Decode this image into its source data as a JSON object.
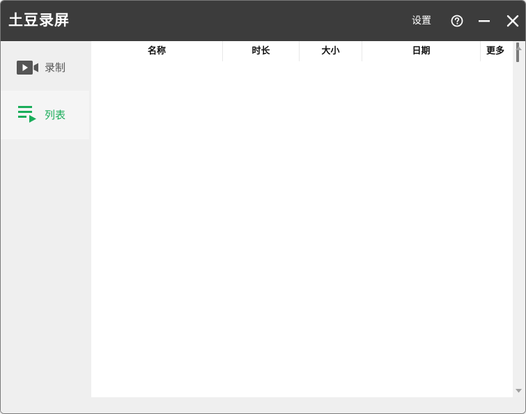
{
  "titlebar": {
    "title": "土豆录屏",
    "settings_label": "设置",
    "help_icon": "help-circle-icon",
    "minimize_icon": "minimize-icon",
    "close_icon": "close-icon"
  },
  "sidebar": {
    "items": [
      {
        "label": "录制",
        "icon": "video-camera-icon",
        "active": false
      },
      {
        "label": "列表",
        "icon": "playlist-icon",
        "active": true
      }
    ]
  },
  "table": {
    "columns": [
      "名称",
      "时长",
      "大小",
      "日期",
      "更多"
    ],
    "rows": []
  },
  "colors": {
    "titlebar_bg": "#3c3c3c",
    "accent": "#1aad5a",
    "sidebar_bg": "#efefef",
    "content_bg": "#ffffff"
  }
}
